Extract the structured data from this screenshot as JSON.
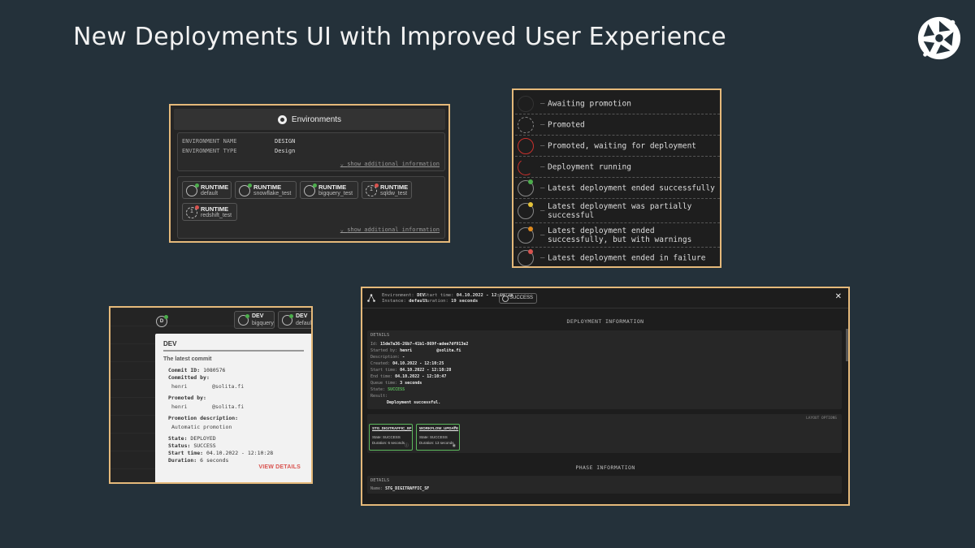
{
  "slide": {
    "title": "New Deployments UI with Improved User Experience",
    "logo_icon": "aperture-logo-icon"
  },
  "environments_panel": {
    "header": "Environments",
    "fields": [
      {
        "label": "ENVIRONMENT NAME",
        "value": "DESIGN"
      },
      {
        "label": "ENVIRONMENT TYPE",
        "value": "Design"
      }
    ],
    "more_link": "show additional information",
    "runtimes": [
      {
        "label": "RUNTIME",
        "name": "default",
        "status": "success",
        "status_color": "#4cae4c",
        "badge": ""
      },
      {
        "label": "RUNTIME",
        "name": "snowflake_test",
        "status": "success",
        "status_color": "#4cae4c",
        "badge": ""
      },
      {
        "label": "RUNTIME",
        "name": "bigquery_test",
        "status": "success",
        "status_color": "#4cae4c",
        "badge": ""
      },
      {
        "label": "RUNTIME",
        "name": "sqldw_test",
        "status": "failure",
        "status_color": "#d9534f",
        "badge": "1"
      },
      {
        "label": "RUNTIME",
        "name": "redshift_test",
        "status": "failure",
        "status_color": "#d9534f",
        "badge": "1"
      }
    ],
    "more_link_bottom": "show additional information"
  },
  "legend": {
    "items": [
      {
        "text": "Awaiting promotion",
        "style": "none"
      },
      {
        "text": "Promoted",
        "style": "dash"
      },
      {
        "text": "Promoted, waiting for deployment",
        "style": "red"
      },
      {
        "text": "Deployment running",
        "style": "arc"
      },
      {
        "text": "Latest deployment ended successfully",
        "style": "dot",
        "dot_color": "#4cae4c"
      },
      {
        "text": "Latest deployment was partially successful",
        "style": "dot",
        "dot_color": "#e5c33a"
      },
      {
        "text": "Latest deployment ended successfully, but with warnings",
        "style": "dot",
        "dot_color": "#e08a1e"
      },
      {
        "text": "Latest deployment ended in failure",
        "style": "dot",
        "dot_color": "#d9534f"
      }
    ],
    "separator": "–"
  },
  "commit_panel": {
    "badge": "D",
    "runtimes": [
      {
        "label": "DEV",
        "name": "bigquery"
      },
      {
        "label": "DEV",
        "name": "default"
      }
    ],
    "popover": {
      "title": "DEV",
      "subtitle": "The latest commit",
      "commit_id_label": "Commit ID:",
      "commit_id": "1080576",
      "committed_by_label": "Committed by:",
      "committed_by_user": "henri",
      "committed_by_domain": "@solita.fi",
      "promoted_by_label": "Promoted by:",
      "promoted_by_user": "henri",
      "promoted_by_domain": "@solita.fi",
      "promotion_desc_label": "Promotion description:",
      "promotion_desc": "Automatic promotion",
      "state_label": "State:",
      "state": "DEPLOYED",
      "status_label": "Status:",
      "status": "SUCCESS",
      "start_label": "Start time:",
      "start": "04.10.2022 - 12:10:28",
      "duration_label": "Duration:",
      "duration": "6 seconds",
      "view_details": "VIEW DETAILS"
    }
  },
  "deploy_panel": {
    "env_label": "Environment:",
    "env": "DEV",
    "instance_label": "Instance:",
    "instance": "default",
    "start_label": "Start time:",
    "start": "04.10.2022 - 12:10:28",
    "duration_label": "Duration:",
    "duration": "19 seconds",
    "status": "SUCCESS",
    "close": "✕",
    "deployment_info_title": "DEPLOYMENT INFORMATION",
    "details_header": "DETAILS",
    "details": [
      {
        "label": "Id:",
        "value": "15de7a36-26b7-41b1-869f-adee7df913e2"
      },
      {
        "label": "Started by:",
        "value": "henri          @solita.fi"
      },
      {
        "label": "Description:",
        "value": "-"
      },
      {
        "label": "Created:",
        "value": "04.10.2022 - 12:10:25"
      },
      {
        "label": "Start time:",
        "value": "04.10.2022 - 12:10:28"
      },
      {
        "label": "End time:",
        "value": "04.10.2022 - 12:10:47"
      },
      {
        "label": "Queue time:",
        "value": "3 seconds"
      },
      {
        "label": "State:",
        "value": "SUCCESS"
      },
      {
        "label": "Result:",
        "value": ""
      }
    ],
    "result_text": "Deployment successful.",
    "layout_options": "LAYOUT OPTIONS",
    "steps": [
      {
        "name": "STG_DIGITRAFFIC_SF",
        "state": "State: SUCCESS",
        "duration": "Duration: 6 seconds"
      },
      {
        "name": "WORKFLOW_UPDATE",
        "state": "State: SUCCESS",
        "duration": "Duration: 13 seconds"
      }
    ],
    "phase_info_title": "PHASE INFORMATION",
    "phase_details_header": "DETAILS",
    "phase_name_label": "Name:",
    "phase_name": "STG_DIGITRAFFIC_SF"
  }
}
